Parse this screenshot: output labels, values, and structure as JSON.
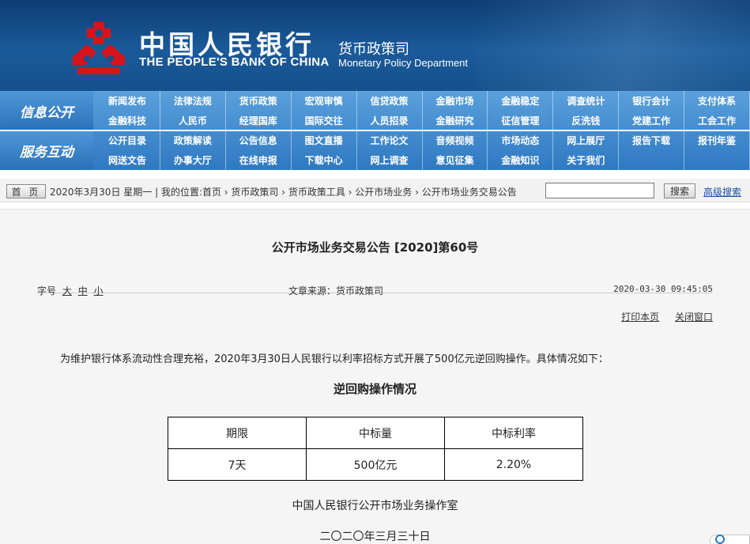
{
  "header": {
    "bank_cn": "中国人民银行",
    "bank_en": "THE PEOPLE'S BANK OF CHINA",
    "dept_cn": "货币政策司",
    "dept_en": "Monetary Policy Department",
    "colors": {
      "banner": "#15508c",
      "nav": "#2f79c2",
      "emblem": "#d7141a"
    }
  },
  "nav": {
    "section1_label": "信息公开",
    "section2_label": "服务互动",
    "rows": [
      [
        "新闻发布",
        "法律法规",
        "货币政策",
        "宏观审慎",
        "信贷政策",
        "金融市场",
        "金融稳定",
        "调查统计",
        "银行会计",
        "支付体系"
      ],
      [
        "金融科技",
        "人民币",
        "经理国库",
        "国际交往",
        "人员招录",
        "金融研究",
        "征信管理",
        "反洗钱",
        "党建工作",
        "工会工作"
      ],
      [
        "公开目录",
        "政策解读",
        "公告信息",
        "图文直播",
        "工作论文",
        "音频视频",
        "市场动态",
        "网上展厅",
        "报告下载",
        "报刊年鉴"
      ],
      [
        "网送文告",
        "办事大厅",
        "在线申报",
        "下载中心",
        "网上调查",
        "意见征集",
        "金融知识",
        "关于我们",
        "",
        ""
      ]
    ]
  },
  "crumb": {
    "home_label": "首 页",
    "date_text": "2020年3月30日 星期一",
    "path_text": "我的位置:首页 › 货币政策司 › 货币政策工具 › 公开市场业务 › 公开市场业务交易公告",
    "search_value": "",
    "search_button": "搜索",
    "advanced_search": "高级搜索"
  },
  "article": {
    "title": "公开市场业务交易公告 [2020]第60号",
    "font_size_label": "字号",
    "font_sizes": [
      "大",
      "中",
      "小"
    ],
    "source": "文章来源：货币政策司",
    "time": "2020-03-30 09:45:05",
    "print_link": "打印本页",
    "close_link": "关闭窗口",
    "intro": "为维护银行体系流动性合理充裕，2020年3月30日人民银行以利率招标方式开展了500亿元逆回购操作。具体情况如下：",
    "subtitle": "逆回购操作情况",
    "table": {
      "headers": [
        "期限",
        "中标量",
        "中标利率"
      ],
      "rows": [
        [
          "7天",
          "500亿元",
          "2.20%"
        ]
      ]
    },
    "signature": "中国人民银行公开市场业务操作室",
    "date_cn": "二〇二〇年三月三十日"
  }
}
